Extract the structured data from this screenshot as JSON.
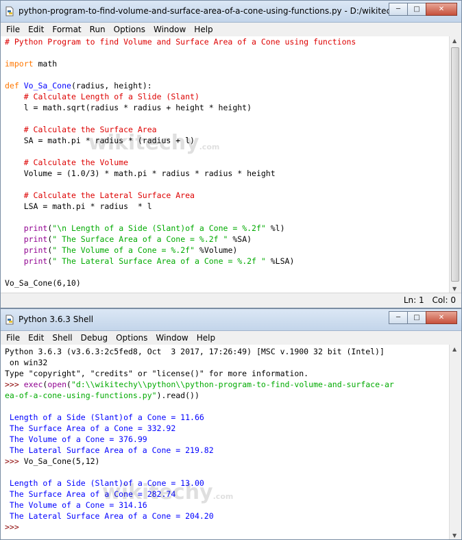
{
  "editor_window": {
    "title": "python-program-to-find-volume-and-surface-area-of-a-cone-using-functions.py - D:/wikitechy/pyth...",
    "menu": [
      "File",
      "Edit",
      "Format",
      "Run",
      "Options",
      "Window",
      "Help"
    ],
    "lines": [
      "# Python Program to find Volume and Surface Area of a Cone using functions",
      "",
      "import math",
      "",
      "def Vo_Sa_Cone(radius, height):",
      "    # Calculate Length of a Slide (Slant)",
      "    l = math.sqrt(radius * radius + height * height)",
      "",
      "    # Calculate the Surface Area",
      "    SA = math.pi * radius * (radius + l)",
      "",
      "    # Calculate the Volume",
      "    Volume = (1.0/3) * math.pi * radius * radius * height",
      "",
      "    # Calculate the Lateral Surface Area",
      "    LSA = math.pi * radius  * l",
      "",
      "    print(\"\\n Length of a Side (Slant)of a Cone = %.2f\" %l)",
      "    print(\" The Surface Area of a Cone = %.2f \" %SA)",
      "    print(\" The Volume of a Cone = %.2f\" %Volume)",
      "    print(\" The Lateral Surface Area of a Cone = %.2f \" %LSA)",
      "",
      "Vo_Sa_Cone(6,10)"
    ],
    "status": {
      "ln": "Ln: 1",
      "col": "Col: 0"
    }
  },
  "shell_window": {
    "title": "Python 3.6.3 Shell",
    "menu": [
      "File",
      "Edit",
      "Shell",
      "Debug",
      "Options",
      "Window",
      "Help"
    ],
    "banner1": "Python 3.6.3 (v3.6.3:2c5fed8, Oct  3 2017, 17:26:49) [MSC v.1900 32 bit (Intel)]",
    "banner2": " on win32",
    "banner3": "Type \"copyright\", \"credits\" or \"license()\" for more information.",
    "prompt": ">>> ",
    "exec_part1": "exec(open(\"d:\\\\wikitechy\\\\python\\\\python-program-to-find-volume-and-surface-ar",
    "exec_part2": "ea-of-a-cone-using-functions.py\").read())",
    "run1": [
      " Length of a Side (Slant)of a Cone = 11.66",
      " The Surface Area of a Cone = 332.92",
      " The Volume of a Cone = 376.99",
      " The Lateral Surface Area of a Cone = 219.82"
    ],
    "call2": "Vo_Sa_Cone(5,12)",
    "run2": [
      " Length of a Side (Slant)of a Cone = 13.00",
      " The Surface Area of a Cone = 282.74",
      " The Volume of a Cone = 314.16",
      " The Lateral Surface Area of a Cone = 204.20"
    ],
    "final_prompt": ">>>"
  },
  "watermark": "wikitechy",
  "watermark_sub": ".com"
}
